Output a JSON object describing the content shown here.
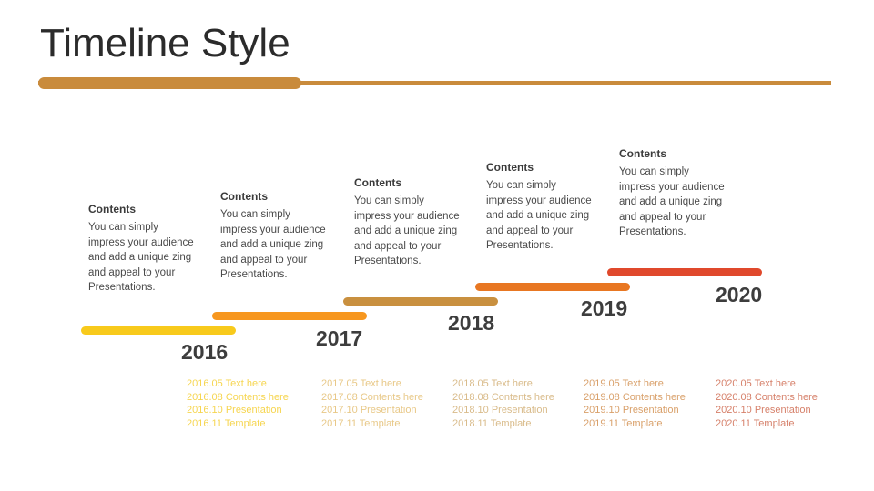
{
  "slide": {
    "title": "Timeline Style",
    "background": "#ffffff",
    "accent_rule_color": "#c98b3c"
  },
  "contents_block": {
    "heading": "Contents",
    "body": "You can simply impress your audience and add a unique zing and appeal to your Presentations."
  },
  "timeline": {
    "columns": [
      {
        "year": "2016",
        "bar_color": "#f8ca1c",
        "detail_color": "#f6d54f",
        "contents_heading": "Contents",
        "contents_body": "You can simply impress your audience and add a unique zing and appeal to your Presentations.",
        "details": [
          "2016.05 Text here",
          "2016.08 Contents here",
          "2016.10 Presentation",
          "2016.11 Template"
        ]
      },
      {
        "year": "2017",
        "bar_color": "#f7971f",
        "detail_color": "#e8c887",
        "contents_heading": "Contents",
        "contents_body": "You can simply impress your audience and add a unique zing and appeal to your Presentations.",
        "details": [
          "2017.05 Text here",
          "2017.08 Contents here",
          "2017.10 Presentation",
          "2017.11 Template"
        ]
      },
      {
        "year": "2018",
        "bar_color": "#c9903f",
        "detail_color": "#d9bb8a",
        "contents_heading": "Contents",
        "contents_body": "You can simply impress your audience and add a unique zing and appeal to your Presentations.",
        "details": [
          "2018.05 Text here",
          "2018.08 Contents here",
          "2018.10 Presentation",
          "2018.11 Template"
        ]
      },
      {
        "year": "2019",
        "bar_color": "#e87722",
        "detail_color": "#d9a06a",
        "contents_heading": "Contents",
        "contents_body": "You can simply impress your audience and add a unique zing and appeal to your Presentations.",
        "details": [
          "2019.05 Text here",
          "2019.08 Contents here",
          "2019.10 Presentation",
          "2019.11 Template"
        ]
      },
      {
        "year": "2020",
        "bar_color": "#e0492c",
        "detail_color": "#d6806a",
        "contents_heading": "Contents",
        "contents_body": "You can simply impress your audience and add a unique zing and appeal to your Presentations.",
        "details": [
          "2020.05 Text here",
          "2020.08 Contents here",
          "2020.10 Presentation",
          "2020.11 Template"
        ]
      }
    ]
  }
}
